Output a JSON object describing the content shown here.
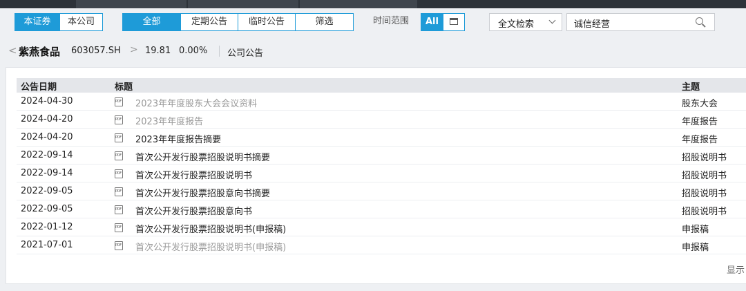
{
  "scope_tabs": [
    {
      "label": "本证券",
      "active": true
    },
    {
      "label": "本公司",
      "active": false
    }
  ],
  "type_tabs": [
    {
      "label": "全部",
      "active": true
    },
    {
      "label": "定期公告",
      "active": false
    },
    {
      "label": "临时公告",
      "active": false
    },
    {
      "label": "筛选",
      "active": false
    }
  ],
  "time_range": {
    "label": "时间范围",
    "all_label": "All",
    "calendar_icon": "calendar-icon"
  },
  "search": {
    "mode": "全文检索",
    "value": "诚信经营",
    "icon": "search-icon"
  },
  "breadcrumb": {
    "back": "<",
    "name": "紫燕食品",
    "code": "603057.SH",
    "sep": ">",
    "price": "19.81",
    "change": "0.00%",
    "section": "公司公告"
  },
  "table": {
    "headers": {
      "date": "公告日期",
      "title": "标题",
      "topic": "主题"
    },
    "rows": [
      {
        "date": "2024-04-30",
        "title": "2023年年度股东大会会议资料",
        "topic": "股东大会",
        "visited": true
      },
      {
        "date": "2024-04-20",
        "title": "2023年年度报告",
        "topic": "年度报告",
        "visited": true
      },
      {
        "date": "2024-04-20",
        "title": "2023年年度报告摘要",
        "topic": "年度报告",
        "visited": false
      },
      {
        "date": "2022-09-14",
        "title": "首次公开发行股票招股说明书摘要",
        "topic": "招股说明书",
        "visited": false
      },
      {
        "date": "2022-09-14",
        "title": "首次公开发行股票招股说明书",
        "topic": "招股说明书",
        "visited": false
      },
      {
        "date": "2022-09-05",
        "title": "首次公开发行股票招股意向书摘要",
        "topic": "招股说明书",
        "visited": false
      },
      {
        "date": "2022-09-05",
        "title": "首次公开发行股票招股意向书",
        "topic": "招股说明书",
        "visited": false
      },
      {
        "date": "2022-01-12",
        "title": "首次公开发行股票招股说明书(申报稿)",
        "topic": "申报稿",
        "visited": false
      },
      {
        "date": "2021-07-01",
        "title": "首次公开发行股票招股说明书(申报稿)",
        "topic": "申报稿",
        "visited": true
      }
    ],
    "footer": "显示"
  },
  "colors": {
    "accent": "#1e9bd8",
    "visited": "#999999"
  }
}
